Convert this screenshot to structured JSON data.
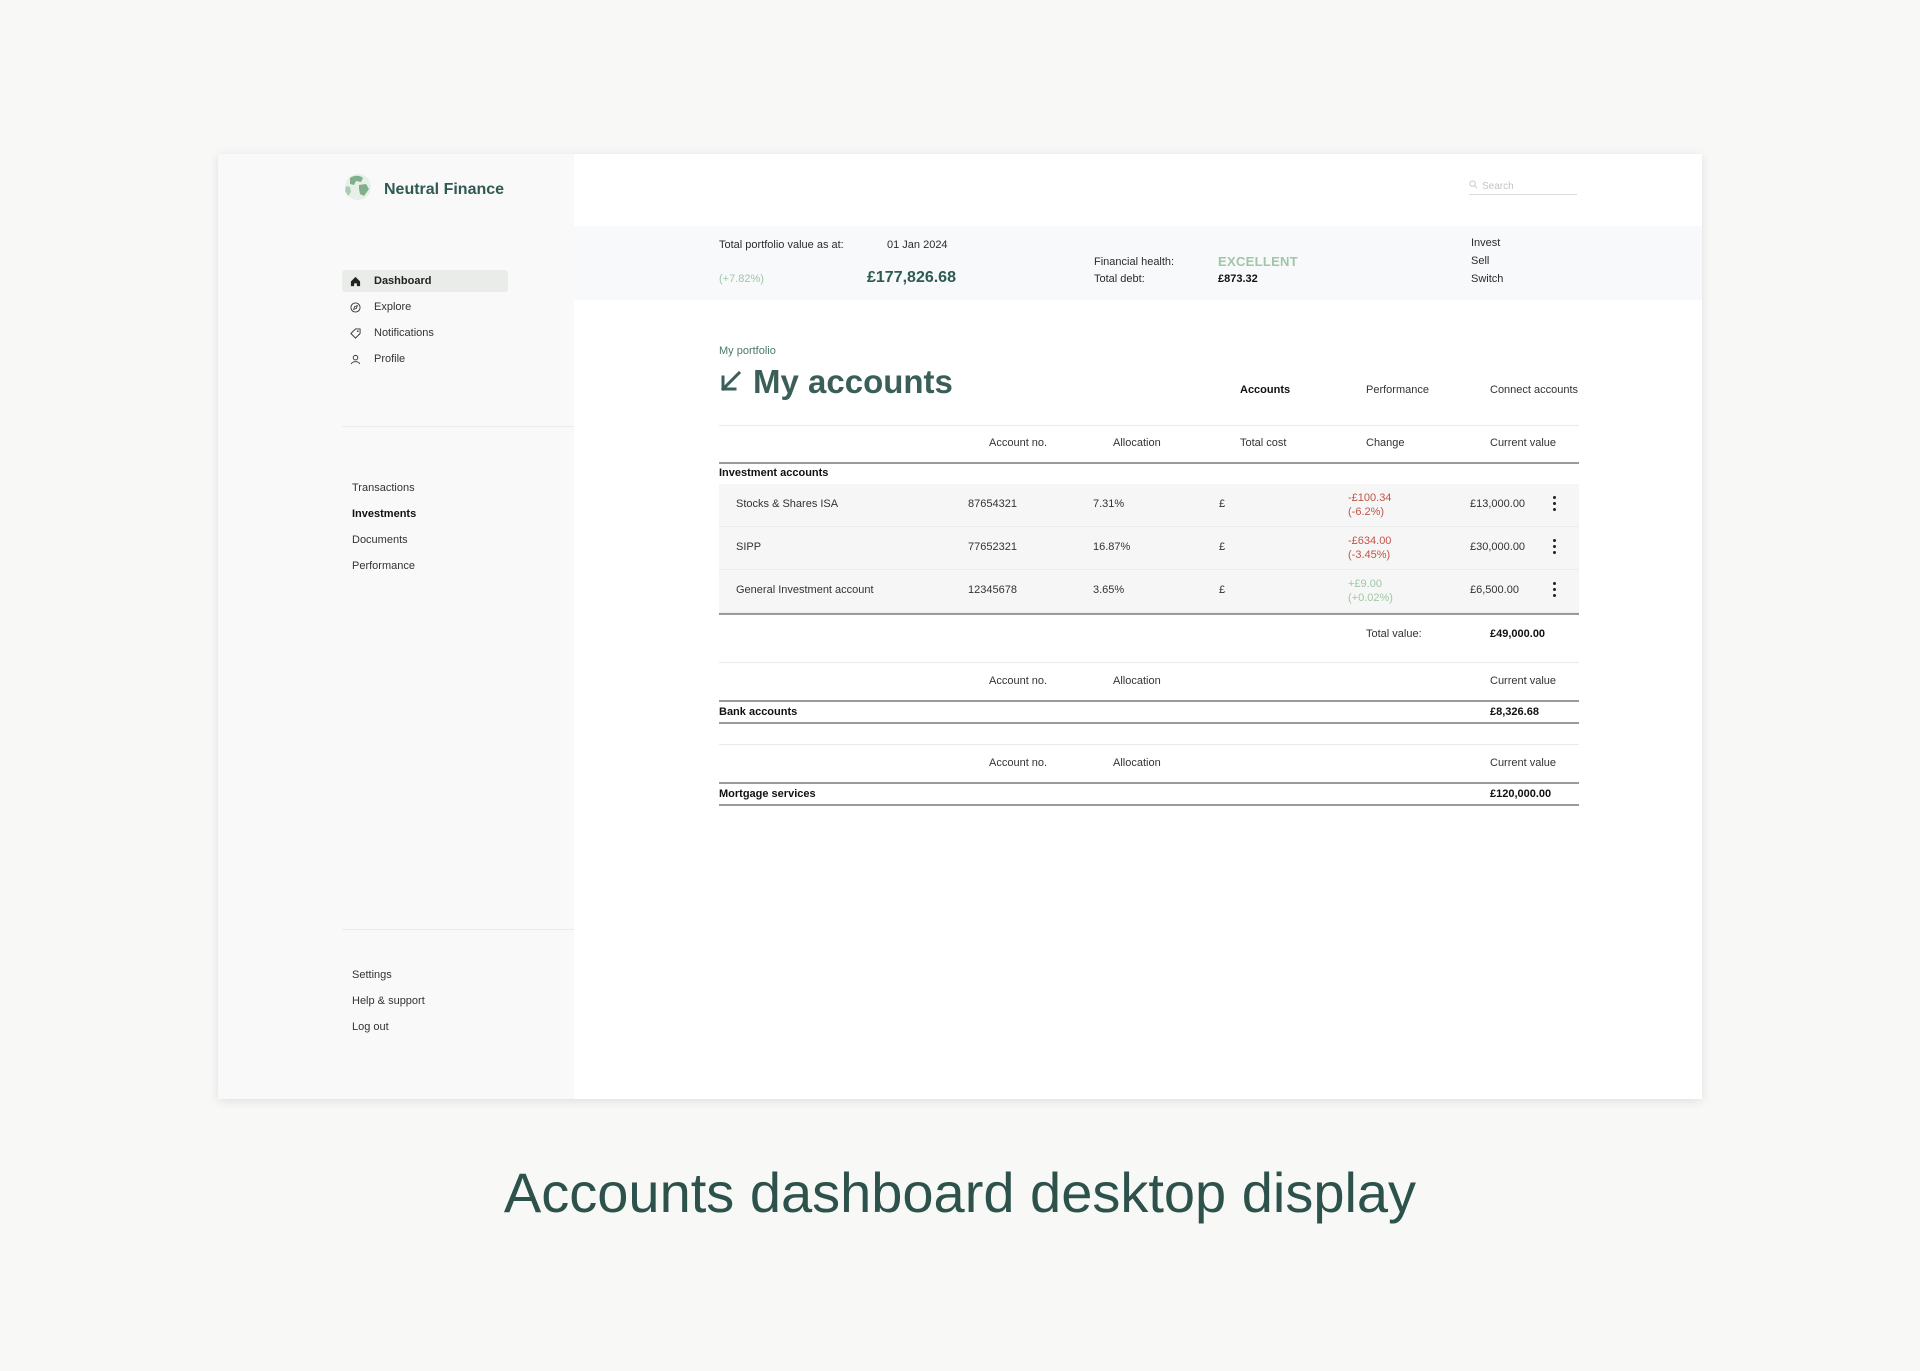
{
  "app": {
    "name": "Neutral Finance"
  },
  "sidebar": {
    "nav": [
      {
        "label": "Dashboard",
        "icon": "home-icon",
        "active": true
      },
      {
        "label": "Explore",
        "icon": "compass-icon",
        "active": false
      },
      {
        "label": "Notifications",
        "icon": "tag-icon",
        "active": false
      },
      {
        "label": "Profile",
        "icon": "user-icon",
        "active": false
      }
    ],
    "sub": [
      {
        "label": "Transactions"
      },
      {
        "label": "Investments"
      },
      {
        "label": "Documents"
      },
      {
        "label": "Performance"
      }
    ],
    "footer": [
      {
        "label": "Settings"
      },
      {
        "label": "Help & support"
      },
      {
        "label": "Log out"
      }
    ]
  },
  "search": {
    "placeholder": "Search"
  },
  "summary": {
    "portfolio_label": "Total portfolio value as at:",
    "date": "01 Jan 2024",
    "change_pct": "(+7.82%)",
    "total_value": "£177,826.68",
    "health_label": "Financial health:",
    "health_value": "EXCELLENT",
    "debt_label": "Total debt:",
    "debt_value": "£873.32",
    "actions": [
      "Invest",
      "Sell",
      "Switch"
    ]
  },
  "page": {
    "breadcrumb": "My portfolio",
    "title": "My accounts",
    "tabs": [
      "Accounts",
      "Performance",
      "Connect accounts"
    ]
  },
  "investment": {
    "headers": [
      "Account no.",
      "Allocation",
      "Total cost",
      "Change",
      "Current value"
    ],
    "group": "Investment accounts",
    "rows": [
      {
        "name": "Stocks & Shares ISA",
        "no": "87654321",
        "alloc": "7.31%",
        "cost": "£",
        "change": "-£100.34",
        "change_pct": "(-6.2%)",
        "value": "£13,000.00"
      },
      {
        "name": "SIPP",
        "no": "77652321",
        "alloc": "16.87%",
        "cost": "£",
        "change": "-£634.00",
        "change_pct": "(-3.45%)",
        "value": "£30,000.00"
      },
      {
        "name": "General Investment account",
        "no": "12345678",
        "alloc": "3.65%",
        "cost": "£",
        "change": "+£9.00",
        "change_pct": "(+0.02%)",
        "value": "£6,500.00"
      }
    ],
    "total_label": "Total value:",
    "total_value": "£49,000.00"
  },
  "bank": {
    "headers": [
      "Account no.",
      "Allocation",
      "Current value"
    ],
    "group": "Bank accounts",
    "value": "£8,326.68"
  },
  "mortgage": {
    "headers": [
      "Account no.",
      "Allocation",
      "Current value"
    ],
    "group": "Mortgage services",
    "value": "£120,000.00"
  },
  "caption": "Accounts dashboard desktop display",
  "colors": {
    "brand": "#2e5a52",
    "positive": "#9fc7a6",
    "negative": "#c0554a"
  }
}
